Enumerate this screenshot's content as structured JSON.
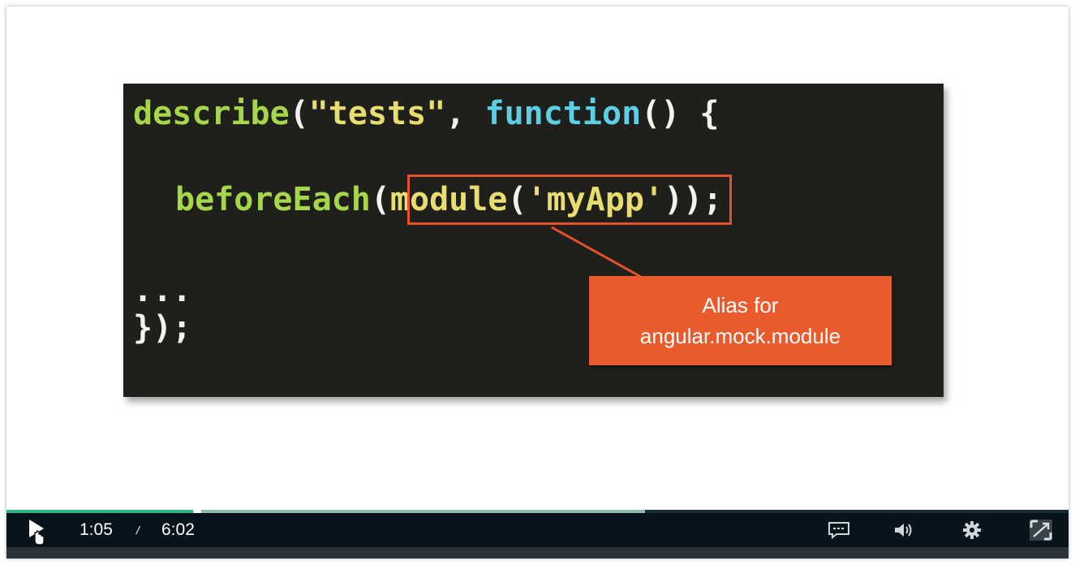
{
  "slide": {
    "code": {
      "line1": {
        "describe": "describe",
        "open": "(",
        "tests": "\"tests\"",
        "comma": ", ",
        "function": "function",
        "rest": "() {"
      },
      "line2": {
        "beforeEach": "beforeEach",
        "open": "(",
        "module": "module",
        "paren": "(",
        "myApp": "'myApp'",
        "close": "))",
        "semi": ";"
      },
      "line3": "...",
      "line4": "});"
    },
    "callout": {
      "line1": "Alias for",
      "line2": "angular.mock.module"
    }
  },
  "player": {
    "current_time": "1:05",
    "separator": "/",
    "duration": "6:02",
    "progress_played_fraction": 0.1798,
    "progress_buffered_fraction": 0.601,
    "icons": {
      "play": "play-icon",
      "cursor": "hand-cursor-icon",
      "captions": "captions-icon",
      "volume": "volume-icon",
      "settings": "gear-icon",
      "fullscreen": "fullscreen-icon"
    }
  },
  "colors": {
    "code_background": "#1f1f1c",
    "keyword_green": "#a6d64a",
    "string_yellow": "#e8dd6f",
    "keyword_cyan": "#5ccfe6",
    "callout_orange": "#e95a2c",
    "progress_played": "#2fb57f",
    "controls_background": "#07141c"
  }
}
